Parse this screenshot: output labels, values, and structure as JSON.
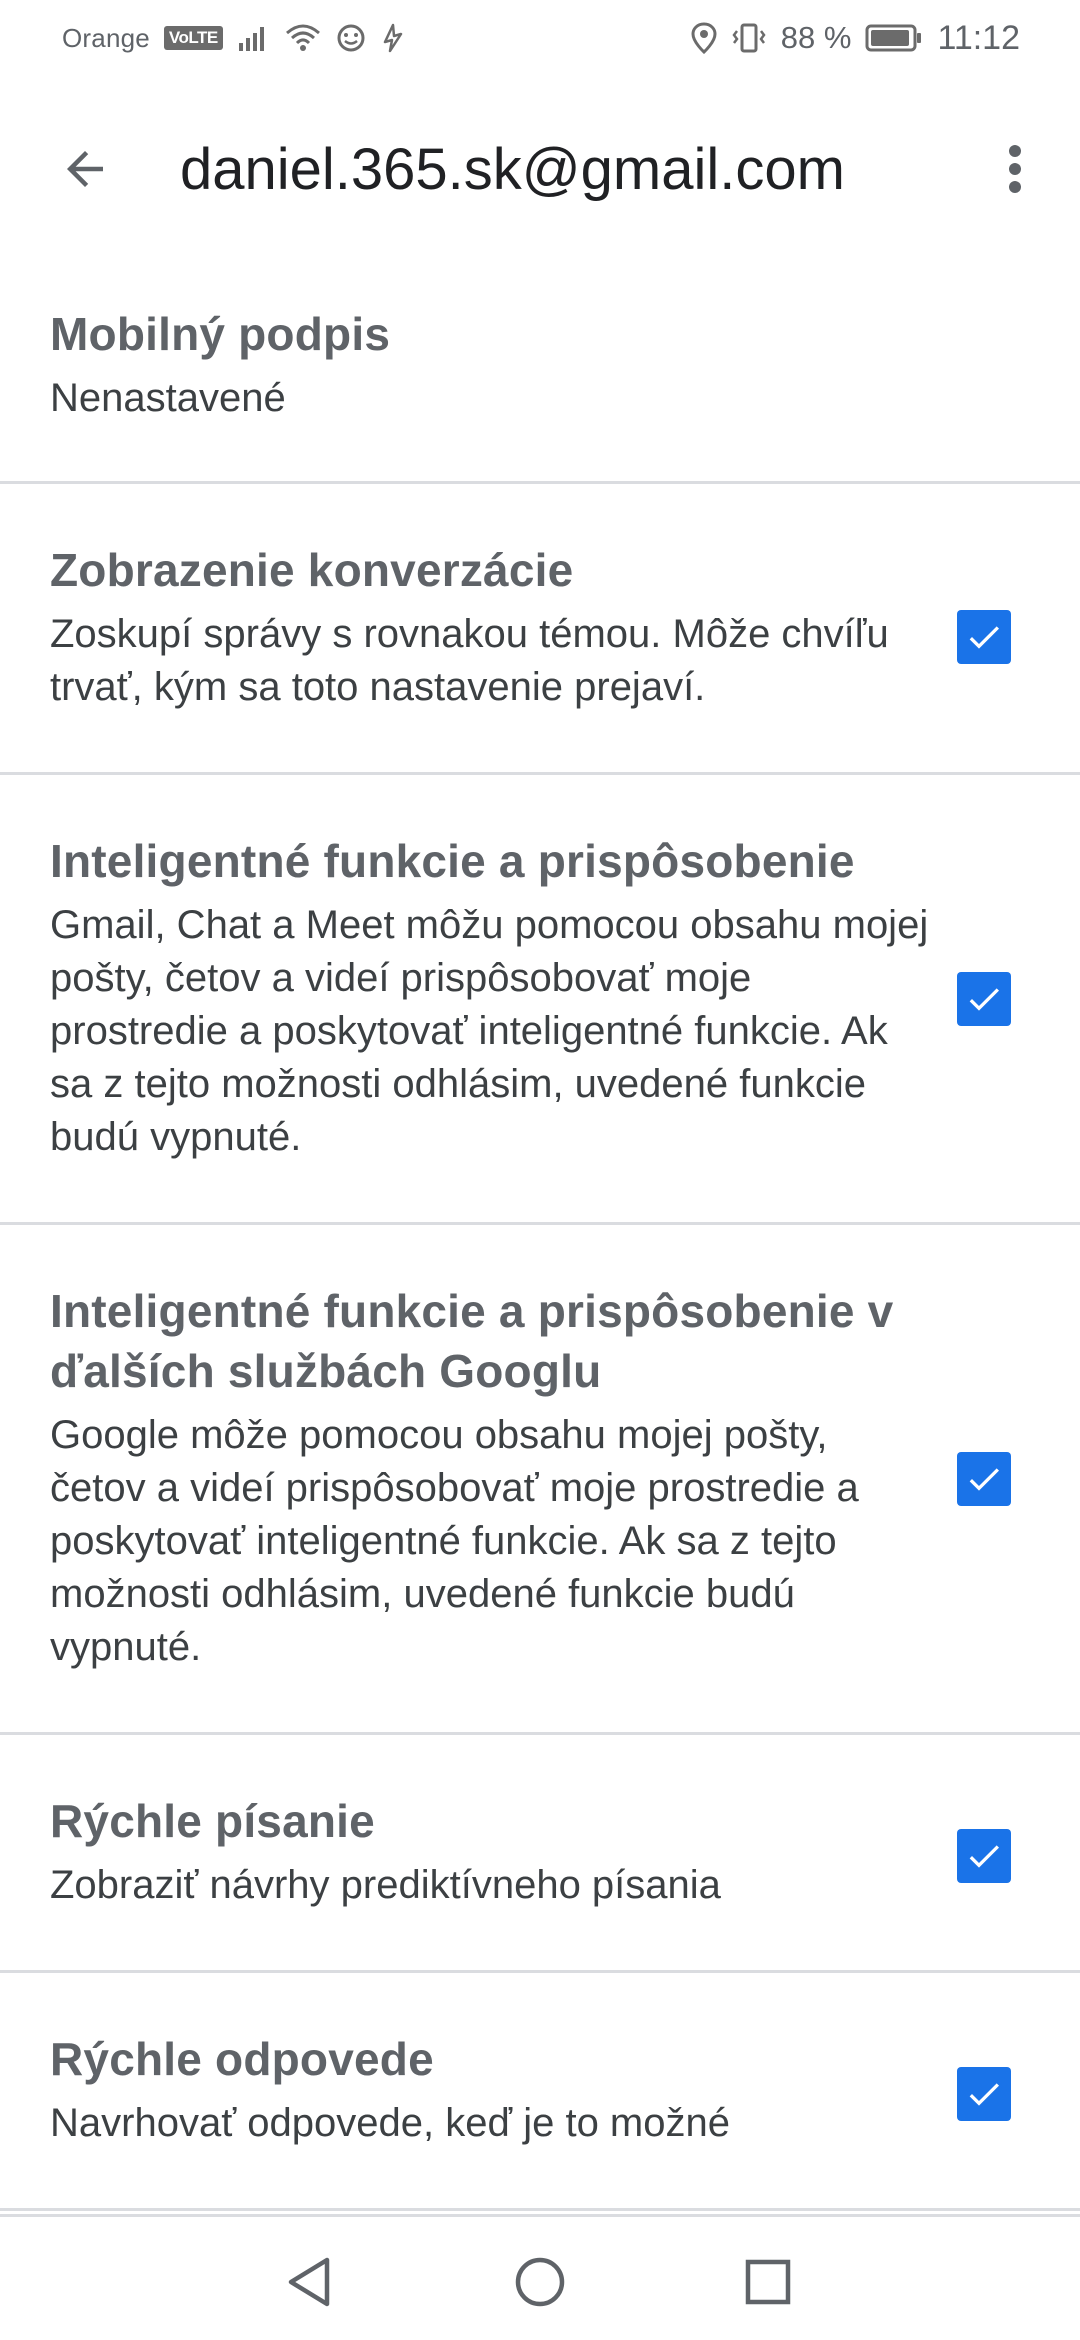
{
  "status_bar": {
    "carrier": "Orange",
    "volte": "VoLTE",
    "battery": "88 %",
    "time": "11:12",
    "icons": [
      "signal-icon",
      "wifi-icon",
      "face-icon",
      "data-icon",
      "location-icon",
      "vibrate-icon",
      "battery-icon"
    ]
  },
  "app_bar": {
    "title": "daniel.365.sk@gmail.com",
    "back_icon": "arrow-back-icon",
    "more_icon": "more-vert-icon"
  },
  "settings": [
    {
      "title": "Mobilný podpis",
      "description": "Nenastavené",
      "has_checkbox": false
    },
    {
      "title": "Zobrazenie konverzácie",
      "description": "Zoskupí správy s rovnakou témou. Môže chvíľu trvať, kým sa toto nastavenie prejaví.",
      "has_checkbox": true,
      "checked": true
    },
    {
      "title": "Inteligentné funkcie a prispôsobenie",
      "description": "Gmail, Chat a Meet môžu pomocou obsahu mojej pošty, četov a videí prispôsobovať moje prostredie a poskytovať inteligentné funkcie. Ak sa z tejto možnosti odhlásim, uvedené funkcie budú vypnuté.",
      "has_checkbox": true,
      "checked": true
    },
    {
      "title": "Inteligentné funkcie a prispôsobenie v ďalších službách Googlu",
      "description": "Google môže pomocou obsahu mojej pošty, četov a videí prispôsobovať moje prostredie a poskytovať inteligentné funkcie. Ak sa z tejto možnosti odhlásim, uvedené funkcie budú vypnuté.",
      "has_checkbox": true,
      "checked": true
    },
    {
      "title": "Rýchle písanie",
      "description": "Zobraziť návrhy prediktívneho písania",
      "has_checkbox": true,
      "checked": true
    },
    {
      "title": "Rýchle odpovede",
      "description": "Navrhovať odpovede, keď je to možné",
      "has_checkbox": true,
      "checked": true
    }
  ],
  "nav_bar": {
    "back_icon": "nav-back-icon",
    "home_icon": "nav-home-icon",
    "recents_icon": "nav-recents-icon"
  },
  "colors": {
    "accent": "#1a73e8",
    "divider": "#dadce0",
    "title_gray": "#5f6368"
  }
}
